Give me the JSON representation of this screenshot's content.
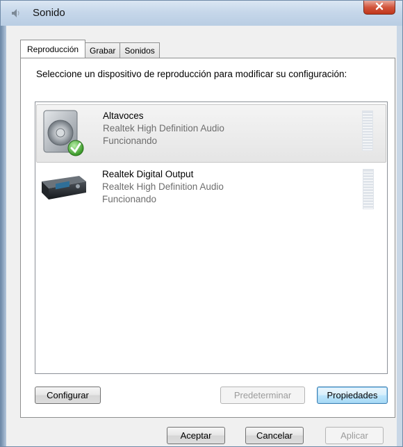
{
  "window": {
    "title": "Sonido",
    "close_label": "x"
  },
  "tabs": [
    {
      "label": "Reproducción",
      "active": true
    },
    {
      "label": "Grabar",
      "active": false
    },
    {
      "label": "Sonidos",
      "active": false
    }
  ],
  "panel": {
    "instruction": "Seleccione un dispositivo de reproducción para modificar su configuración:",
    "devices": [
      {
        "name": "Altavoces",
        "driver": "Realtek High Definition Audio",
        "status": "Funcionando",
        "icon": "speaker-icon",
        "is_default": true,
        "selected": true
      },
      {
        "name": "Realtek Digital Output",
        "driver": "Realtek High Definition Audio",
        "status": "Funcionando",
        "icon": "digital-output-icon",
        "is_default": false,
        "selected": false
      }
    ],
    "buttons": {
      "configure": "Configurar",
      "set_default": "Predeterminar",
      "properties": "Propiedades"
    }
  },
  "footer": {
    "ok": "Aceptar",
    "cancel": "Cancelar",
    "apply": "Aplicar"
  }
}
